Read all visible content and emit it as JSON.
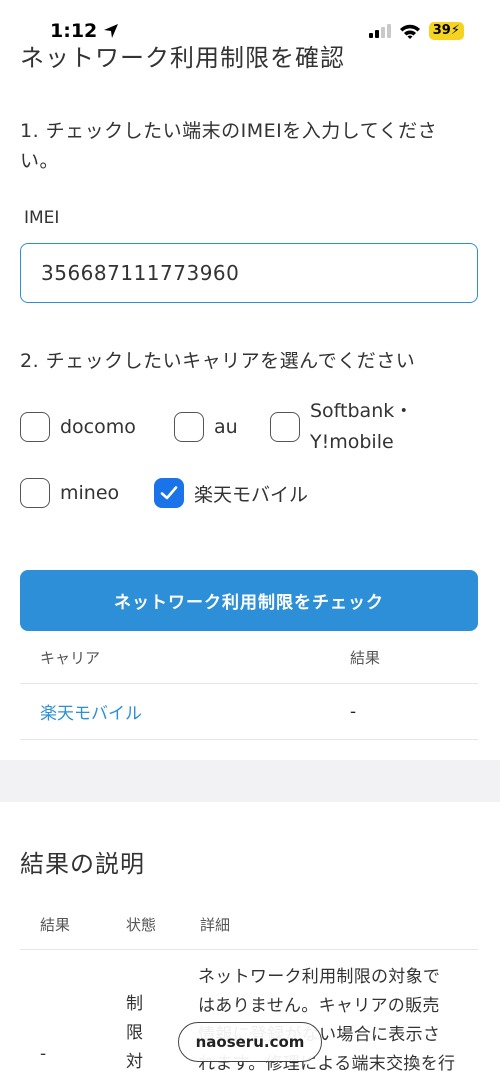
{
  "status": {
    "time": "1:12",
    "battery": "39"
  },
  "page": {
    "title": "ネットワーク利用制限を確認"
  },
  "form": {
    "step1_text": "1. チェックしたい端末のIMEIを入力してください。",
    "imei_label": "IMEI",
    "imei_value": "356687111773960",
    "step2_text": "2. チェックしたいキャリアを選んでください",
    "carriers": [
      {
        "label": "docomo",
        "checked": false
      },
      {
        "label": "au",
        "checked": false
      },
      {
        "label": "Softbank・Y!mobile",
        "line1": "Softbank・",
        "line2": "Y!mobile",
        "checked": false
      },
      {
        "label": "mineo",
        "checked": false
      },
      {
        "label": "楽天モバイル",
        "checked": true
      }
    ],
    "check_button": "ネットワーク利用制限をチェック"
  },
  "results": {
    "headers": {
      "carrier": "キャリア",
      "result": "結果"
    },
    "rows": [
      {
        "carrier": "楽天モバイル",
        "result": "-"
      }
    ]
  },
  "explanation": {
    "title": "結果の説明",
    "headers": {
      "result": "結果",
      "state": "状態",
      "detail": "詳細"
    },
    "row": {
      "result": "-",
      "state": "制限対象",
      "detail": "ネットワーク利用制限の対象ではありません。キャリアの販売情報に登録がない場合に表示されます。修理による端末交換を行った場"
    }
  },
  "browser": {
    "url": "naoseru.com"
  },
  "colors": {
    "accent": "#2d8fd8",
    "checkbox_checked": "#1a73e8",
    "battery": "#f4d321"
  }
}
